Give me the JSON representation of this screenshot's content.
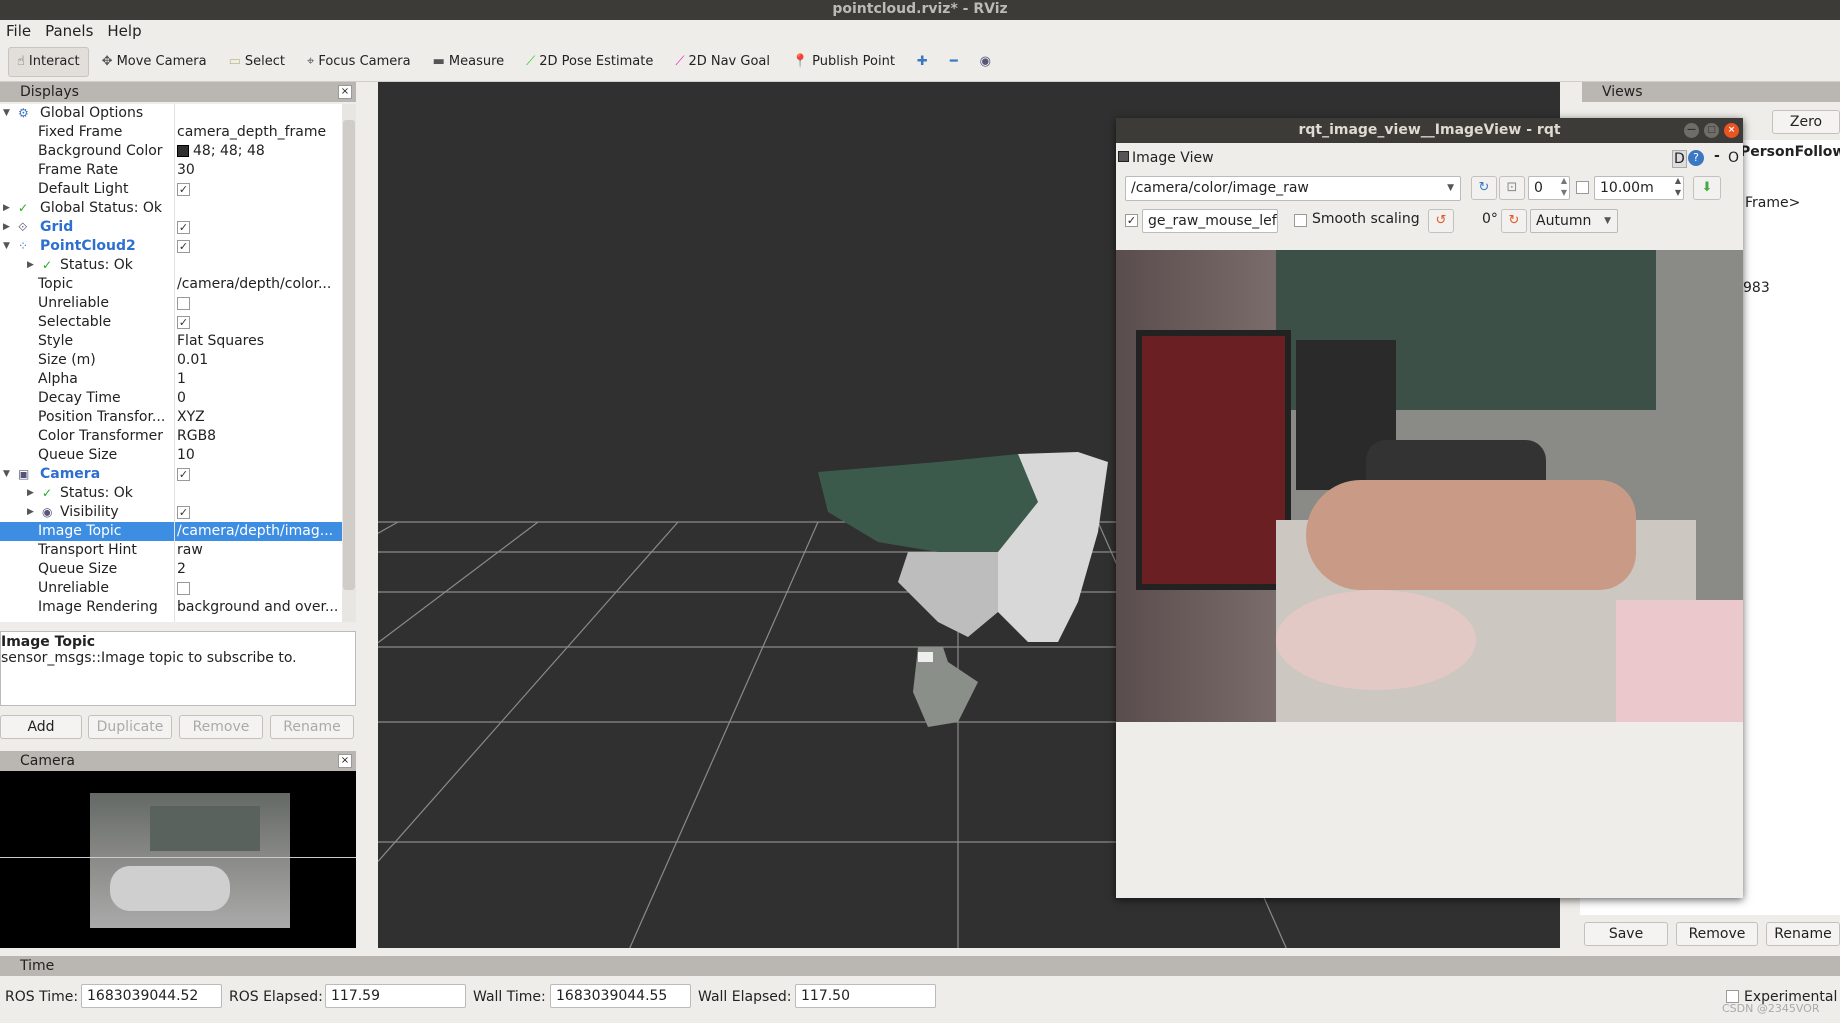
{
  "window": {
    "title": "pointcloud.rviz* - RViz"
  },
  "menu": [
    "File",
    "Panels",
    "Help"
  ],
  "toolbar": [
    {
      "label": "Interact",
      "icon": "hand-icon",
      "active": true
    },
    {
      "label": "Move Camera",
      "icon": "move-icon"
    },
    {
      "label": "Select",
      "icon": "select-icon"
    },
    {
      "label": "Focus Camera",
      "icon": "focus-icon"
    },
    {
      "label": "Measure",
      "icon": "ruler-icon"
    },
    {
      "label": "2D Pose Estimate",
      "icon": "green-arrow-icon"
    },
    {
      "label": "2D Nav Goal",
      "icon": "pink-arrow-icon"
    },
    {
      "label": "Publish Point",
      "icon": "pin-icon"
    }
  ],
  "displays": {
    "title": "Displays",
    "rows": [
      {
        "label": "Global Options",
        "level": 0,
        "exp": "open",
        "icon": "gear-icon"
      },
      {
        "label": "Fixed Frame",
        "level": 1,
        "value": "camera_depth_frame"
      },
      {
        "label": "Background Color",
        "level": 1,
        "value": "48; 48; 48",
        "swatch": "#303030"
      },
      {
        "label": "Frame Rate",
        "level": 1,
        "value": "30"
      },
      {
        "label": "Default Light",
        "level": 1,
        "check": true
      },
      {
        "label": "Global Status: Ok",
        "level": 0,
        "exp": "closed",
        "icon": "check-icon"
      },
      {
        "label": "Grid",
        "level": 0,
        "exp": "closed",
        "icon": "grid-icon",
        "blue": true,
        "check": true
      },
      {
        "label": "PointCloud2",
        "level": 0,
        "exp": "open",
        "icon": "pointcloud-icon",
        "blue": true,
        "check": true
      },
      {
        "label": "Status: Ok",
        "level": 1,
        "exp": "closed",
        "icon": "check-icon"
      },
      {
        "label": "Topic",
        "level": 1,
        "value": "/camera/depth/color..."
      },
      {
        "label": "Unreliable",
        "level": 1,
        "check": false
      },
      {
        "label": "Selectable",
        "level": 1,
        "check": true
      },
      {
        "label": "Style",
        "level": 1,
        "value": "Flat Squares"
      },
      {
        "label": "Size (m)",
        "level": 1,
        "value": "0.01"
      },
      {
        "label": "Alpha",
        "level": 1,
        "value": "1"
      },
      {
        "label": "Decay Time",
        "level": 1,
        "value": "0"
      },
      {
        "label": "Position Transfor...",
        "level": 1,
        "value": "XYZ"
      },
      {
        "label": "Color Transformer",
        "level": 1,
        "value": "RGB8"
      },
      {
        "label": "Queue Size",
        "level": 1,
        "value": "10"
      },
      {
        "label": "Camera",
        "level": 0,
        "exp": "open",
        "icon": "camera-icon",
        "blue": true,
        "check": true
      },
      {
        "label": "Status: Ok",
        "level": 1,
        "exp": "closed",
        "icon": "check-icon"
      },
      {
        "label": "Visibility",
        "level": 1,
        "exp": "closed",
        "icon": "eye-icon",
        "check": true
      },
      {
        "label": "Image Topic",
        "level": 1,
        "value": "/camera/depth/imag...",
        "selected": true
      },
      {
        "label": "Transport Hint",
        "level": 1,
        "value": "raw"
      },
      {
        "label": "Queue Size",
        "level": 1,
        "value": "2"
      },
      {
        "label": "Unreliable",
        "level": 1,
        "check": false
      },
      {
        "label": "Image Rendering",
        "level": 1,
        "value": "background and over..."
      }
    ],
    "desc_title": "Image Topic",
    "desc_text": "sensor_msgs::Image topic to subscribe to.",
    "buttons": {
      "add": "Add",
      "duplicate": "Duplicate",
      "remove": "Remove",
      "rename": "Rename"
    }
  },
  "camera_panel": {
    "title": "Camera"
  },
  "views": {
    "title": "Views",
    "zero": "Zero",
    "line1": "PersonFollow...",
    "line2": "Frame>",
    "line3": "983",
    "save": "Save",
    "remove": "Remove",
    "rename": "Rename"
  },
  "rqt": {
    "title": "rqt_image_view__ImageView - rqt",
    "plugin": "Image View",
    "d_label": "D",
    "help": "?",
    "dash": "-",
    "o": "O",
    "topic": "/camera/color/image_raw",
    "spin_value": "0",
    "max_value": "10.00m",
    "mouse_topic": "ge_raw_mouse_left",
    "mouse_checked": true,
    "smooth": "Smooth scaling",
    "rotation": "0°",
    "colormap": "Autumn"
  },
  "time": {
    "title": "Time",
    "ros_time_label": "ROS Time:",
    "ros_time": "1683039044.52",
    "ros_elapsed_label": "ROS Elapsed:",
    "ros_elapsed": "117.59",
    "wall_time_label": "Wall Time:",
    "wall_time": "1683039044.55",
    "wall_elapsed_label": "Wall Elapsed:",
    "wall_elapsed": "117.50",
    "experimental": "Experimental"
  },
  "watermark": "CSDN @2345VOR"
}
